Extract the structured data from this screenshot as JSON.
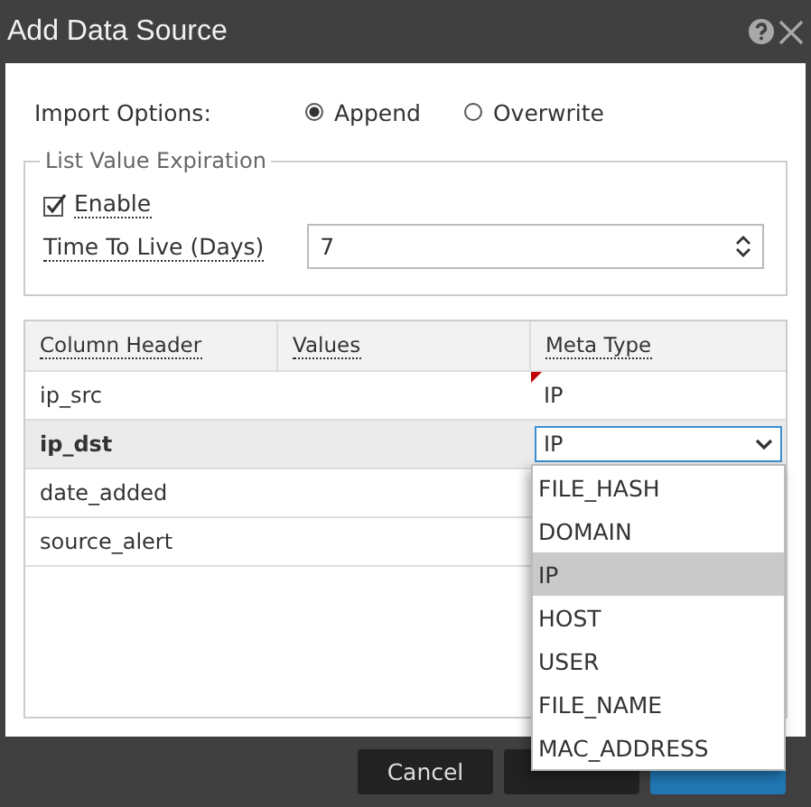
{
  "window": {
    "title": "Add Data Source"
  },
  "import_options": {
    "label": "Import Options:",
    "options": [
      {
        "label": "Append",
        "selected": true
      },
      {
        "label": "Overwrite",
        "selected": false
      }
    ]
  },
  "expiration": {
    "legend": "List Value Expiration",
    "enable": {
      "label": "Enable",
      "checked": true
    },
    "ttl": {
      "label": "Time To Live (Days)",
      "value": "7"
    }
  },
  "table": {
    "columns": [
      "Column Header",
      "Values",
      "Meta Type"
    ],
    "rows": [
      {
        "column_header": "ip_src",
        "meta_type": "IP",
        "selected": false,
        "modified": true
      },
      {
        "column_header": "ip_dst",
        "meta_type": "IP",
        "selected": true,
        "modified": false
      },
      {
        "column_header": "date_added",
        "selected": false,
        "modified": false
      },
      {
        "column_header": "source_alert",
        "selected": false,
        "modified": false
      }
    ]
  },
  "dropdown": {
    "options": [
      {
        "label": "FILE_HASH",
        "selected": false
      },
      {
        "label": "DOMAIN",
        "selected": false
      },
      {
        "label": "IP",
        "selected": true
      },
      {
        "label": "HOST",
        "selected": false
      },
      {
        "label": "USER",
        "selected": false
      },
      {
        "label": "FILE_NAME",
        "selected": false
      },
      {
        "label": "MAC_ADDRESS",
        "selected": false
      }
    ]
  },
  "buttons": [
    {
      "label": "Cancel",
      "kind": "dark"
    },
    {
      "kind": "dark"
    },
    {
      "kind": "primary"
    }
  ]
}
